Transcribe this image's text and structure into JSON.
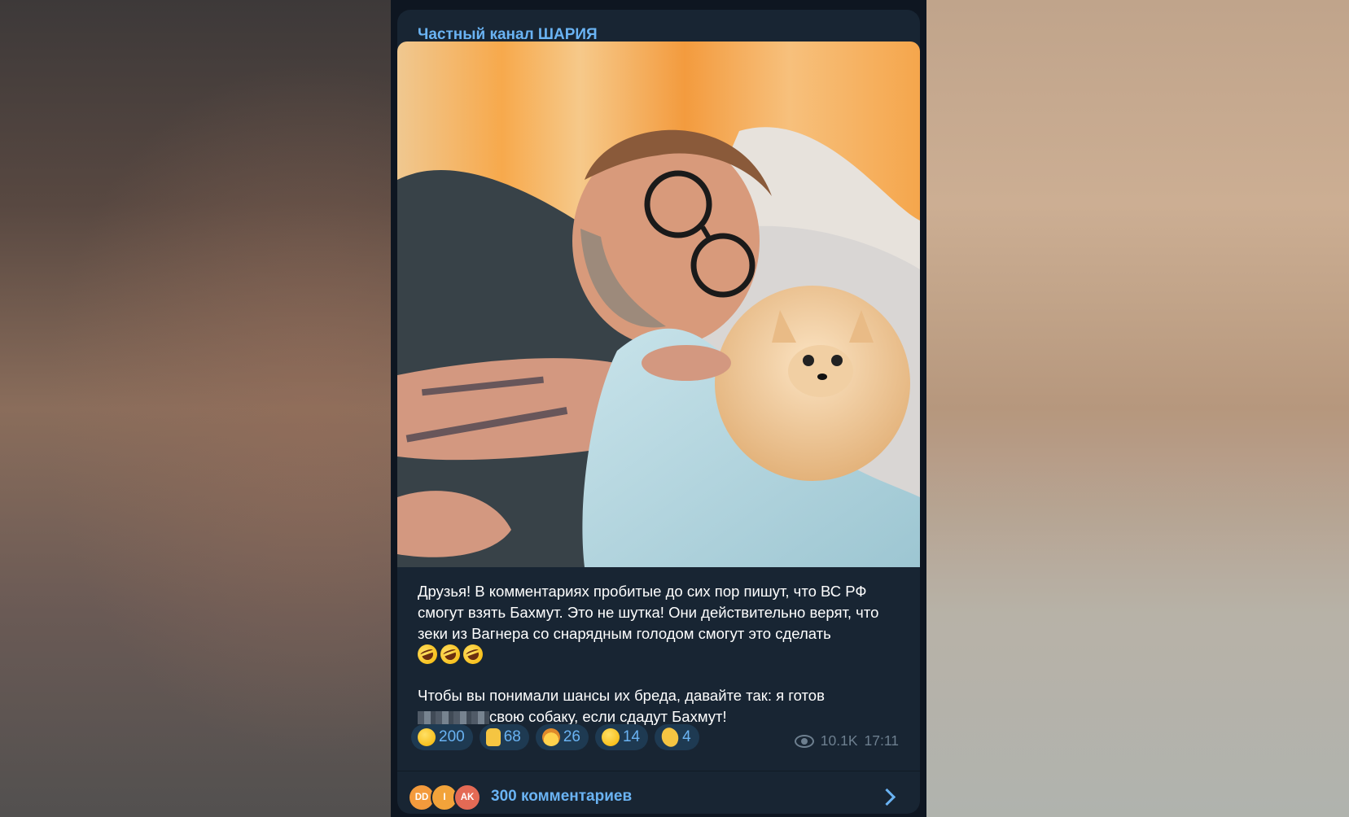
{
  "post": {
    "channel_name": "Частный канал ШАРИЯ",
    "paragraph1": "Друзья! В комментариях пробитые до сих пор пишут, что ВС РФ смогут взять Бахмут. Это не шутка! Они действительно верят, что зеки из Вагнера со снарядным голодом смогут это сделать",
    "paragraph1_emojis": [
      "rolling-laughing",
      "rolling-laughing",
      "rolling-laughing"
    ],
    "paragraph2_start": "Чтобы вы понимали шансы их бреда, давайте так: я готов",
    "paragraph2_end": "свою собаку, если сдадут Бахмут!",
    "views": "10.1K",
    "time": "17:11",
    "comments_label": "300 комментариев"
  },
  "reactions": [
    {
      "icon": "rolling-laughing-emoji",
      "count": "200"
    },
    {
      "icon": "thumbs-up-emoji",
      "count": "68"
    },
    {
      "icon": "exploding-head-emoji",
      "count": "26"
    },
    {
      "icon": "grinning-emoji",
      "count": "14"
    },
    {
      "icon": "clapping-hands-emoji",
      "count": "4"
    }
  ],
  "commenters": [
    {
      "initials": "DD",
      "color": "#f39a3c"
    },
    {
      "initials": "I",
      "color": "#f2a33a"
    },
    {
      "initials": "AK",
      "color": "#e46a55"
    }
  ],
  "colors": {
    "accent": "#6ab3f3",
    "bubble": "#182533",
    "background": "#0e1621"
  }
}
